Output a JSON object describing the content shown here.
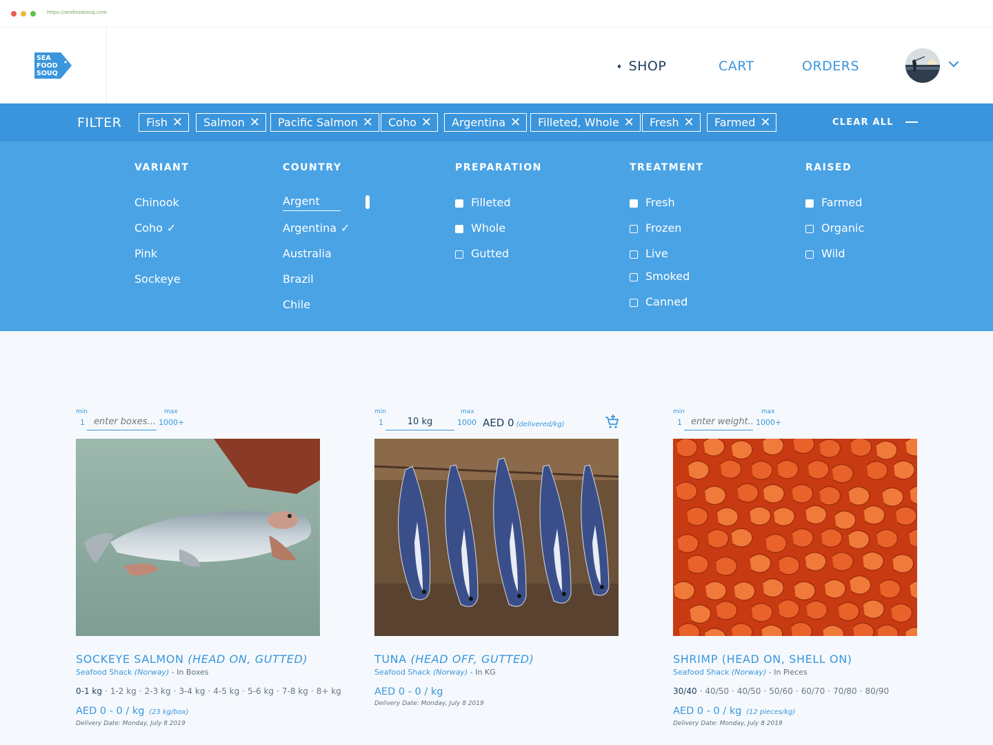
{
  "browser": {
    "url": "https://seafoodsouq.com"
  },
  "logo": {
    "line1": "SEA",
    "line2": "FOOD",
    "line3": "SOUQ",
    "color": "#3a95dc"
  },
  "nav": {
    "shop": "SHOP",
    "cart": "CART",
    "orders": "ORDERS"
  },
  "filter": {
    "title": "FILTER",
    "chips": [
      "Fish",
      "Salmon",
      "Pacific Salmon",
      "Coho",
      "Argentina",
      "Filleted, Whole",
      "Fresh",
      "Farmed"
    ],
    "clear_all": "CLEAR ALL"
  },
  "panel": {
    "variant": {
      "heading": "VARIANT",
      "options": [
        "Chinook",
        "Coho",
        "Pink",
        "Sockeye"
      ],
      "selected": "Coho"
    },
    "country": {
      "heading": "COUNTRY",
      "search_value": "Argent",
      "options": [
        "Argentina",
        "Australia",
        "Brazil",
        "Chile"
      ],
      "selected": "Argentina"
    },
    "preparation": {
      "heading": "PREPARATION",
      "options": [
        {
          "label": "Filleted",
          "checked": true
        },
        {
          "label": "Whole",
          "checked": true
        },
        {
          "label": "Gutted",
          "checked": false
        }
      ]
    },
    "treatment": {
      "heading": "TREATMENT",
      "options": [
        {
          "label": "Fresh",
          "checked": true
        },
        {
          "label": "Frozen",
          "checked": false
        },
        {
          "label": "Live",
          "checked": false
        },
        {
          "label": "Smoked",
          "checked": false
        },
        {
          "label": "Canned",
          "checked": false
        }
      ]
    },
    "raised": {
      "heading": "RAISED",
      "options": [
        {
          "label": "Farmed",
          "checked": true
        },
        {
          "label": "Organic",
          "checked": false
        },
        {
          "label": "Wild",
          "checked": false
        }
      ]
    }
  },
  "products": [
    {
      "qty": {
        "min_label": "min",
        "min": "1",
        "max_label": "max",
        "max": "1000+",
        "placeholder": "enter boxes..."
      },
      "title": "SOCKEYE SALMON",
      "title_detail": "(HEAD ON, GUTTED)",
      "seller": "Seafood Shack",
      "origin": "(Norway)",
      "unit": "- In Boxes",
      "sizes": [
        "0-1 kg",
        "1-2 kg",
        "2-3 kg",
        "3-4 kg",
        "4-5 kg",
        "5-6 kg",
        "7-8 kg",
        "8+ kg"
      ],
      "price": "AED 0 - 0 / kg",
      "price_note": "(23 kg/box)",
      "delivery": "Delivery Date: Monday, July 8 2019"
    },
    {
      "qty": {
        "min_label": "min",
        "min": "1",
        "max_label": "max",
        "max": "1000",
        "value": "10 kg"
      },
      "inline_price": "AED 0",
      "inline_price_note": "(delivered/kg)",
      "title": "TUNA",
      "title_detail": "(HEAD OFF, GUTTED)",
      "seller": "Seafood Shack",
      "origin": "(Norway)",
      "unit": "- In KG",
      "price": "AED 0 - 0 / kg",
      "delivery": "Delivery Date: Monday, July 8 2019"
    },
    {
      "qty": {
        "min_label": "min",
        "min": "1",
        "max_label": "max",
        "max": "1000+",
        "placeholder": "enter weight..."
      },
      "title": "SHRIMP (HEAD ON, SHELL ON)",
      "seller": "Seafood Shack",
      "origin": "(Norway)",
      "unit": "- In Pieces",
      "sizes": [
        "30/40",
        "40/50",
        "40/50",
        "50/60",
        "60/70",
        "70/80",
        "80/90"
      ],
      "price": "AED 0 - 0 / kg",
      "price_note": "(12 pieces/kg)",
      "delivery": "Delivery Date: Monday, July 8 2019"
    }
  ]
}
